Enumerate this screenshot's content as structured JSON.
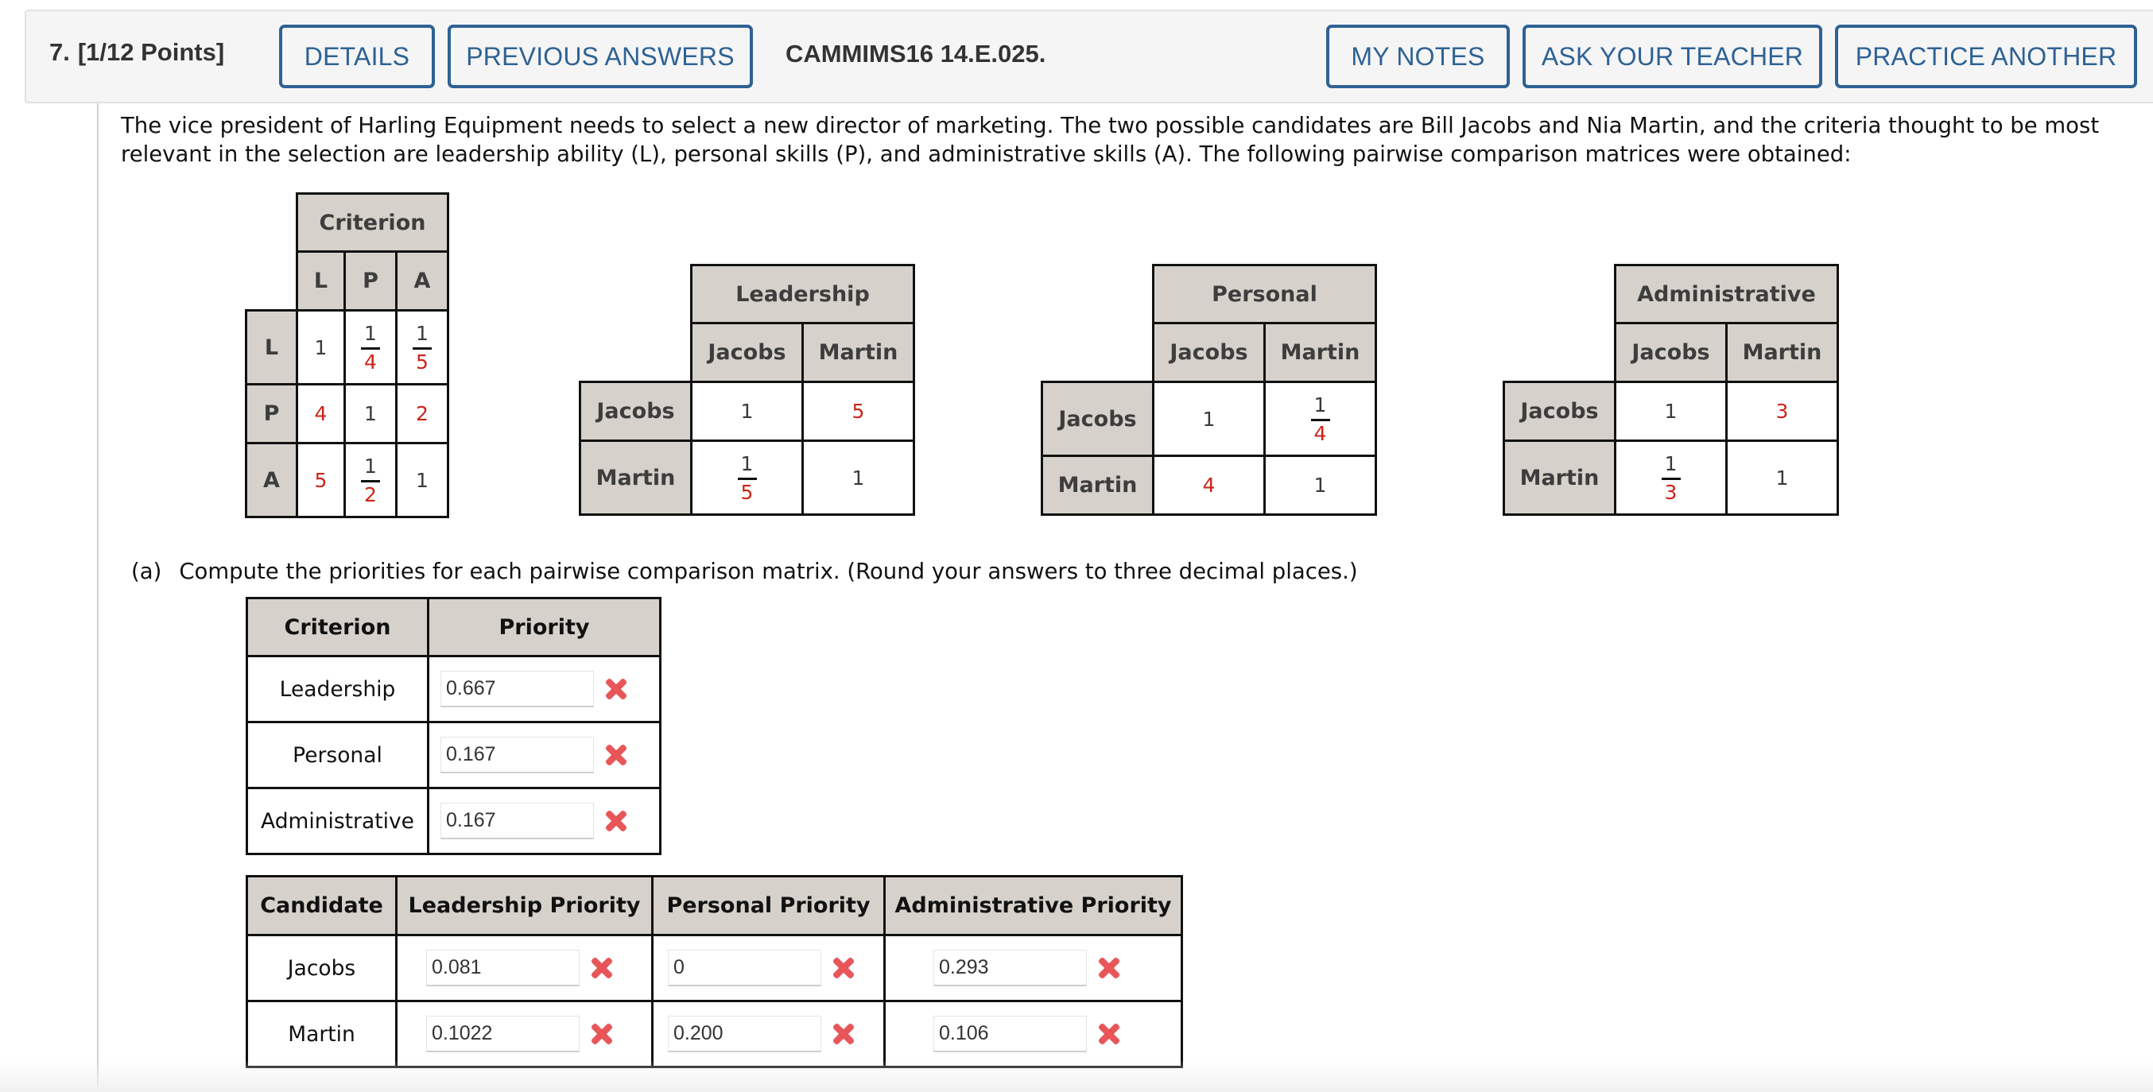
{
  "header": {
    "question_number": "7.",
    "points": "[1/12 Points]",
    "buttons_left": [
      "DETAILS",
      "PREVIOUS ANSWERS"
    ],
    "question_code": "CAMMIMS16 14.E.025.",
    "buttons_right": [
      "MY NOTES",
      "ASK YOUR TEACHER",
      "PRACTICE ANOTHER"
    ]
  },
  "prompt": "The vice president of Harling Equipment needs to select a new director of marketing. The two possible candidates are Bill Jacobs and Nia Martin, and the criteria thought to be most relevant in the selection are leadership ability (L), personal skills (P), and administrative skills (A). The following pairwise comparison matrices were obtained:",
  "criterion_matrix": {
    "title": "Criterion",
    "columns": [
      "L",
      "P",
      "A"
    ],
    "rows": [
      {
        "label": "L",
        "cells": [
          {
            "v": "1"
          },
          {
            "num": "1",
            "den": "4"
          },
          {
            "num": "1",
            "den": "5"
          }
        ]
      },
      {
        "label": "P",
        "cells": [
          {
            "v": "4",
            "red": true
          },
          {
            "v": "1"
          },
          {
            "v": "2",
            "red": true
          }
        ]
      },
      {
        "label": "A",
        "cells": [
          {
            "v": "5",
            "red": true
          },
          {
            "num": "1",
            "den": "2"
          },
          {
            "v": "1"
          }
        ]
      }
    ]
  },
  "candidate_matrices": [
    {
      "title": "Leadership",
      "columns": [
        "Jacobs",
        "Martin"
      ],
      "rows": [
        {
          "label": "Jacobs",
          "cells": [
            {
              "v": "1"
            },
            {
              "v": "5",
              "red": true
            }
          ]
        },
        {
          "label": "Martin",
          "cells": [
            {
              "num": "1",
              "den": "5"
            },
            {
              "v": "1"
            }
          ]
        }
      ]
    },
    {
      "title": "Personal",
      "columns": [
        "Jacobs",
        "Martin"
      ],
      "rows": [
        {
          "label": "Jacobs",
          "cells": [
            {
              "v": "1"
            },
            {
              "num": "1",
              "den": "4"
            }
          ]
        },
        {
          "label": "Martin",
          "cells": [
            {
              "v": "4",
              "red": true
            },
            {
              "v": "1"
            }
          ]
        }
      ]
    },
    {
      "title": "Administrative",
      "columns": [
        "Jacobs",
        "Martin"
      ],
      "rows": [
        {
          "label": "Jacobs",
          "cells": [
            {
              "v": "1"
            },
            {
              "v": "3",
              "red": true
            }
          ]
        },
        {
          "label": "Martin",
          "cells": [
            {
              "num": "1",
              "den": "3"
            },
            {
              "v": "1"
            }
          ]
        }
      ]
    }
  ],
  "part_a": {
    "label": "(a)",
    "instruction": "Compute the priorities for each pairwise comparison matrix. (Round your answers to three decimal places.)",
    "criterion_table": {
      "headers": [
        "Criterion",
        "Priority"
      ],
      "rows": [
        {
          "criterion": "Leadership",
          "value": "0.667",
          "status": "incorrect"
        },
        {
          "criterion": "Personal",
          "value": "0.167",
          "status": "incorrect"
        },
        {
          "criterion": "Administrative",
          "value": "0.167",
          "status": "incorrect"
        }
      ]
    },
    "candidate_table": {
      "headers": [
        "Candidate",
        "Leadership Priority",
        "Personal Priority",
        "Administrative Priority"
      ],
      "rows": [
        {
          "candidate": "Jacobs",
          "values": [
            "0.081",
            "0",
            "0.293"
          ],
          "status": [
            "incorrect",
            "incorrect",
            "incorrect"
          ]
        },
        {
          "candidate": "Martin",
          "values": [
            "0.1022",
            "0.200",
            "0.106"
          ],
          "status": [
            "incorrect",
            "incorrect",
            "incorrect"
          ]
        }
      ]
    }
  },
  "colors": {
    "accent_blue": "#2e6294",
    "header_cell_bg": "#d6d2cb",
    "highlight_red": "#cc2418",
    "incorrect_mark": "#e8565a"
  }
}
